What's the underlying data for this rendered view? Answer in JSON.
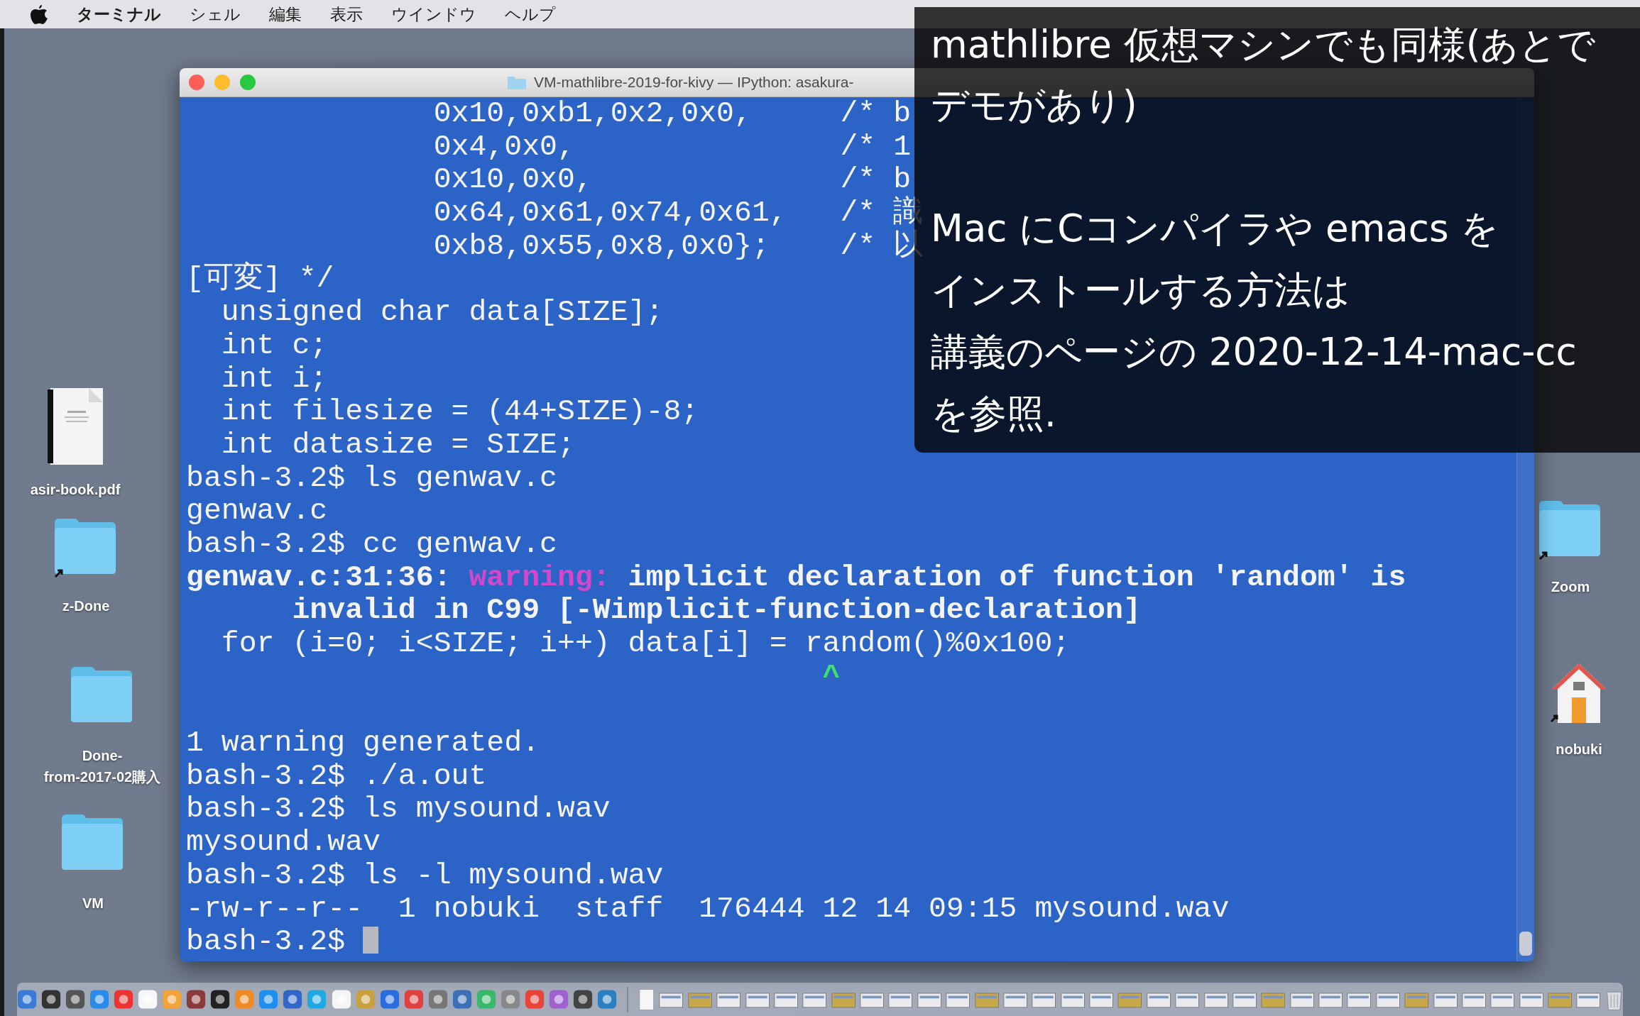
{
  "menu_bar": {
    "app_name": "ターミナル",
    "menus": [
      "シェル",
      "編集",
      "表示",
      "ウインドウ",
      "ヘルプ"
    ]
  },
  "terminal": {
    "title": "VM-mathlibre-2019-for-kivy — IPython: asakura-",
    "lines": [
      {
        "kind": "plain",
        "text": "              0x10,0xb1,0x2,0x0,     /* b"
      },
      {
        "kind": "plain",
        "text": "              0x4,0x0,               /* 1"
      },
      {
        "kind": "plain",
        "text": "              0x10,0x0,              /* b"
      },
      {
        "kind": "plain",
        "text": "              0x64,0x61,0x74,0x61,   /* 識"
      },
      {
        "kind": "plain",
        "text": "              0xb8,0x55,0x8,0x0};    /* 以"
      },
      {
        "kind": "plain",
        "text": "[可変] */"
      },
      {
        "kind": "plain",
        "text": "  unsigned char data[SIZE];"
      },
      {
        "kind": "plain",
        "text": "  int c;"
      },
      {
        "kind": "plain",
        "text": "  int i;"
      },
      {
        "kind": "plain",
        "text": "  int filesize = (44+SIZE)-8;"
      },
      {
        "kind": "plain",
        "text": "  int datasize = SIZE;"
      },
      {
        "kind": "plain",
        "text": "bash-3.2$ ls genwav.c"
      },
      {
        "kind": "plain",
        "text": "genwav.c"
      },
      {
        "kind": "plain",
        "text": "bash-3.2$ cc genwav.c"
      },
      {
        "kind": "diagnostic",
        "location": "genwav.c:31:36: ",
        "severity": "warning:",
        "message": " implicit declaration of function 'random' is"
      },
      {
        "kind": "bold",
        "text": "      invalid in C99 [-Wimplicit-function-declaration]"
      },
      {
        "kind": "plain",
        "text": "  for (i=0; i<SIZE; i++) data[i] = random()%0x100;"
      },
      {
        "kind": "caret",
        "text": "                                    ^"
      },
      {
        "kind": "blank"
      },
      {
        "kind": "plain",
        "text": "1 warning generated."
      },
      {
        "kind": "plain",
        "text": "bash-3.2$ ./a.out"
      },
      {
        "kind": "plain",
        "text": "bash-3.2$ ls mysound.wav"
      },
      {
        "kind": "plain",
        "text": "mysound.wav"
      },
      {
        "kind": "plain",
        "text": "bash-3.2$ ls -l mysound.wav"
      },
      {
        "kind": "plain",
        "text": "-rw-r--r--  1 nobuki  staff  176444 12 14 09:15 mysound.wav"
      },
      {
        "kind": "prompt",
        "text": "bash-3.2$ ",
        "cursor": true
      }
    ]
  },
  "desktop_icons_left": [
    {
      "kind": "document",
      "label": "asir-book.pdf"
    },
    {
      "kind": "folder-alias",
      "label": "z-Done"
    },
    {
      "kind": "folder",
      "label": "Done-\nfrom-2017-02購入"
    },
    {
      "kind": "folder",
      "label": "VM"
    }
  ],
  "desktop_icons_right": [
    {
      "kind": "folder-alias",
      "label": "Zoom"
    },
    {
      "kind": "home-alias",
      "label": "nobuki"
    }
  ],
  "caption": {
    "paragraphs": [
      [
        "mathlibre 仮想マシンでも同様(あとで",
        "デモがあり)"
      ],
      [
        "Mac にCコンパイラや emacs を",
        "インストールする方法は",
        "講義のページの 2020-12-14-mac-cc",
        "を参照."
      ]
    ]
  }
}
